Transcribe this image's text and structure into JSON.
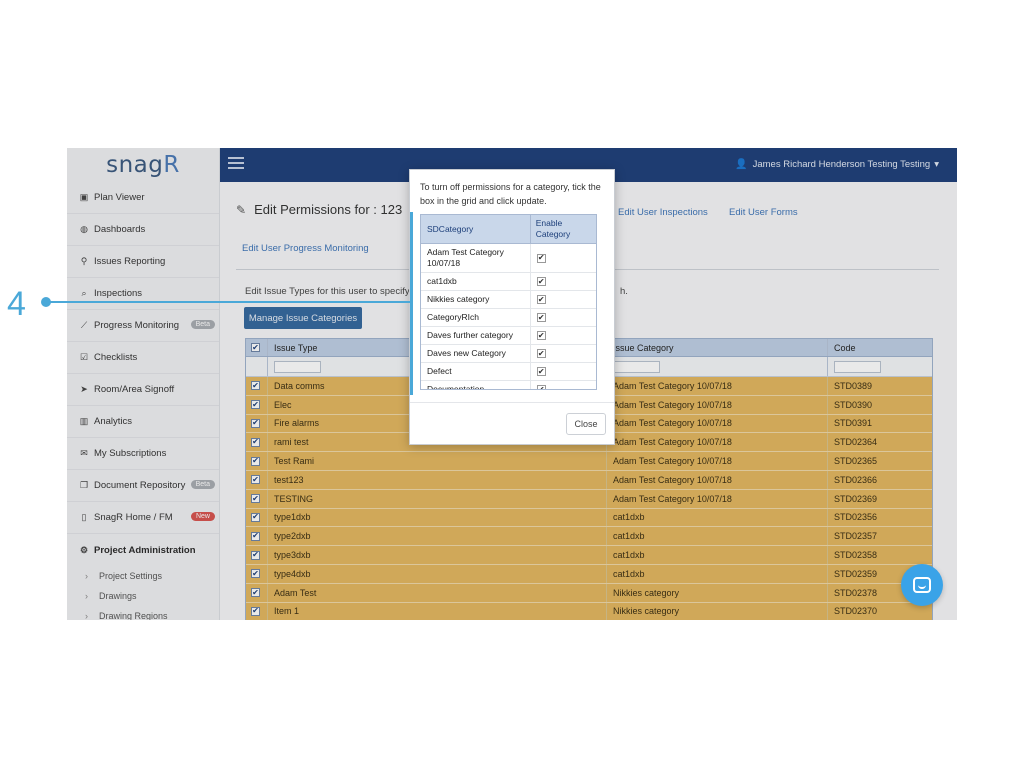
{
  "annotation": {
    "number": "4"
  },
  "app": {
    "logo": {
      "main": "snag",
      "accent": "R"
    },
    "sidebar": {
      "items": [
        {
          "label": "Plan Viewer",
          "icon": "image-icon",
          "glyph": "▣"
        },
        {
          "label": "Dashboards",
          "icon": "palette-icon",
          "glyph": "◍"
        },
        {
          "label": "Issues Reporting",
          "icon": "map-pin-icon",
          "glyph": "⚲"
        },
        {
          "label": "Inspections",
          "icon": "search-icon",
          "glyph": "⌕"
        },
        {
          "label": "Progress Monitoring",
          "icon": "line-chart-icon",
          "glyph": "⟋",
          "badge": "Beta"
        },
        {
          "label": "Checklists",
          "icon": "checkbox-icon",
          "glyph": "☑"
        },
        {
          "label": "Room/Area Signoff",
          "icon": "location-arrow-icon",
          "glyph": "➤"
        },
        {
          "label": "Analytics",
          "icon": "bar-chart-icon",
          "glyph": "▥"
        },
        {
          "label": "My Subscriptions",
          "icon": "envelope-icon",
          "glyph": "✉"
        },
        {
          "label": "Document Repository",
          "icon": "copy-icon",
          "glyph": "❐",
          "badge": "Beta"
        },
        {
          "label": "SnagR Home / FM",
          "icon": "tablet-icon",
          "glyph": "▯",
          "badge": "New"
        }
      ],
      "admin": {
        "label": "Project Administration",
        "glyph": "⚙"
      },
      "sub_items": [
        "Project Settings",
        "Drawings",
        "Drawing Regions"
      ]
    },
    "topbar": {
      "user": "James Richard Henderson Testing Testing",
      "user_glyph": "👤",
      "caret": "▾"
    },
    "page": {
      "title": "Edit Permissions for : 123",
      "title_glyph": "✎",
      "links": [
        "Edit User Inspections",
        "Edit User Forms"
      ],
      "tab_progress": "Edit User Progress Monitoring",
      "description": "Edit Issue Types for this user to specify w",
      "description_tail": "h.",
      "manage_button": "Manage Issue Categories"
    },
    "grid": {
      "columns": [
        "Issue Type",
        "Issue Category",
        "Code"
      ],
      "header_check": "✔",
      "rows": [
        {
          "type": "Data comms",
          "category": "Adam Test Category 10/07/18",
          "code": "STD0389"
        },
        {
          "type": "Elec",
          "category": "Adam Test Category 10/07/18",
          "code": "STD0390"
        },
        {
          "type": "Fire alarms",
          "category": "Adam Test Category 10/07/18",
          "code": "STD0391"
        },
        {
          "type": "rami test",
          "category": "Adam Test Category 10/07/18",
          "code": "STD02364"
        },
        {
          "type": "Test Rami",
          "category": "Adam Test Category 10/07/18",
          "code": "STD02365"
        },
        {
          "type": "test123",
          "category": "Adam Test Category 10/07/18",
          "code": "STD02366"
        },
        {
          "type": "TESTING",
          "category": "Adam Test Category 10/07/18",
          "code": "STD02369"
        },
        {
          "type": "type1dxb",
          "category": "cat1dxb",
          "code": "STD02356"
        },
        {
          "type": "type2dxb",
          "category": "cat1dxb",
          "code": "STD02357"
        },
        {
          "type": "type3dxb",
          "category": "cat1dxb",
          "code": "STD02358"
        },
        {
          "type": "type4dxb",
          "category": "cat1dxb",
          "code": "STD02359"
        },
        {
          "type": "Adam Test",
          "category": "Nikkies category",
          "code": "STD02378"
        },
        {
          "type": "Item 1",
          "category": "Nikkies category",
          "code": "STD02370"
        }
      ]
    },
    "modal": {
      "message": "To turn off permissions for a category, tick the box in the grid and click update.",
      "columns": [
        "SDCategory",
        "Enable Category"
      ],
      "rows": [
        {
          "name": "Adam Test Category 10/07/18",
          "check": "✔"
        },
        {
          "name": "cat1dxb",
          "check": "✔"
        },
        {
          "name": "Nikkies category",
          "check": "✔"
        },
        {
          "name": "CategoryRIch",
          "check": "✔"
        },
        {
          "name": "Daves further category",
          "check": "✔"
        },
        {
          "name": "Daves new Category",
          "check": "✔"
        },
        {
          "name": "Defect",
          "check": "✔"
        },
        {
          "name": "Documentation",
          "check": "✔"
        }
      ],
      "close_label": "Close"
    }
  },
  "colors": {
    "topbar": "#1d3f7a",
    "accent": "#4aa8d8",
    "row_highlight": "#e4b75f",
    "button": "#34689f",
    "chat": "#3aa3e8"
  }
}
